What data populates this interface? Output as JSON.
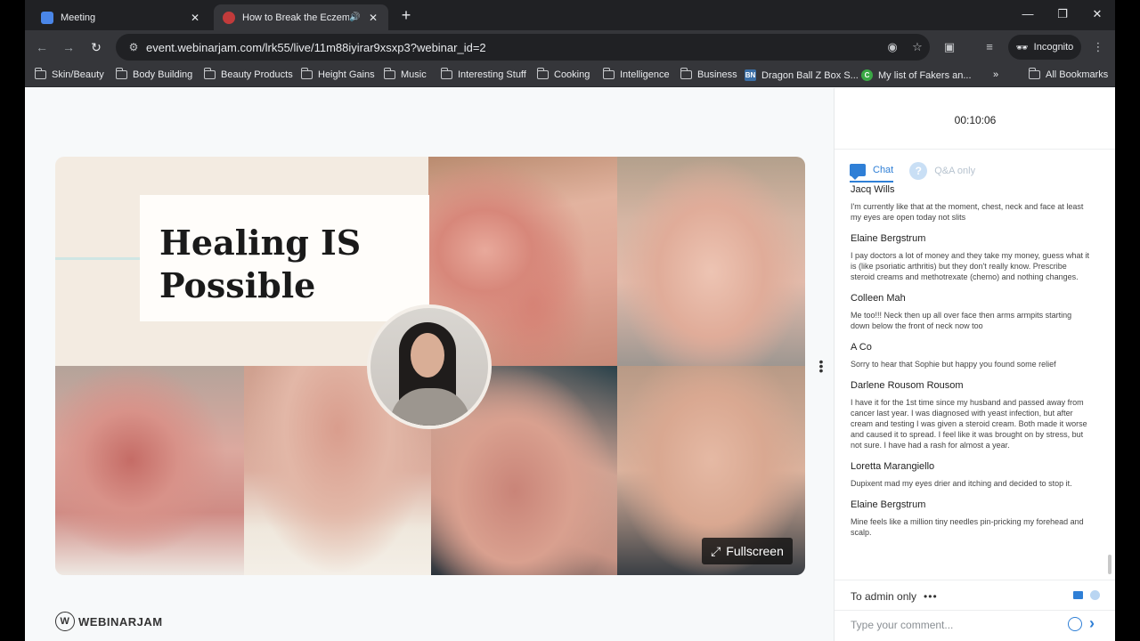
{
  "tabs": [
    {
      "title": "Meeting",
      "fav_color": "#4a86e8"
    },
    {
      "title": "How to Break the Eczema",
      "fav_color": "#c23b3b",
      "active": true
    }
  ],
  "address": {
    "url": "event.webinarjam.com/lrk55/live/11m88iyirar9xsxp3?webinar_id=2"
  },
  "incognito_label": "Incognito",
  "bookmarks": [
    {
      "label": "Skin/Beauty",
      "icon": "folder-icon"
    },
    {
      "label": "Body Building",
      "icon": "folder-icon"
    },
    {
      "label": "Beauty Products",
      "icon": "folder-icon"
    },
    {
      "label": "Height Gains",
      "icon": "folder-icon"
    },
    {
      "label": "Music",
      "icon": "folder-icon"
    },
    {
      "label": "Interesting Stuff",
      "icon": "folder-icon"
    },
    {
      "label": "Cooking",
      "icon": "folder-icon"
    },
    {
      "label": "Intelligence",
      "icon": "folder-icon"
    },
    {
      "label": "Business",
      "icon": "folder-icon"
    },
    {
      "label": "Dragon Ball Z Box S...",
      "icon": "dbz-favicon",
      "badge": "BN"
    },
    {
      "label": "My list of Fakers an...",
      "icon": "green-favicon",
      "badge": "C"
    },
    {
      "label": "All Bookmarks",
      "icon": "folder-icon"
    }
  ],
  "slide": {
    "title": "Healing IS\nPossible",
    "fullscreen_label": "Fullscreen"
  },
  "brand": {
    "name": "WEBINARJAM"
  },
  "sidebar": {
    "timer": "00:10:06",
    "tab_chat": "Chat",
    "tab_qa": "Q&A only",
    "messages": [
      {
        "name": "Jacq Wills",
        "text": "I'm currently like that at the moment, chest, neck and face at least my eyes are open today not slits"
      },
      {
        "name": "Elaine Bergstrum",
        "text": "I pay doctors a lot of money and they take my money, guess what it is (like psoriatic arthritis) but they don't really know. Prescribe steroid creams and methotrexate (chemo) and nothing changes."
      },
      {
        "name": "Colleen Mah",
        "text": "Me too!!! Neck then up all over face then arms armpits starting down below the front of neck now too"
      },
      {
        "name": "A Co",
        "text": "Sorry to hear that Sophie but happy you found some relief"
      },
      {
        "name": "Darlene Rousom Rousom",
        "text": "I have it for the 1st time since my husband and passed away from cancer last year. I was diagnosed with yeast infection, but after cream and testing I was given a steroid cream. Both made it worse and caused it to spread. I feel like it was brought on by stress, but not sure. I have had a rash for almost a year."
      },
      {
        "name": "Loretta Marangiello",
        "text": "Dupixent mad my eyes drier and itching and decided to stop it."
      },
      {
        "name": "Elaine Bergstrum",
        "text": "Mine feels like a million tiny needles pin-pricking my forehead and scalp."
      }
    ],
    "recipient": "To admin only",
    "recipient_more": "•••",
    "comment_placeholder": "Type your comment..."
  }
}
